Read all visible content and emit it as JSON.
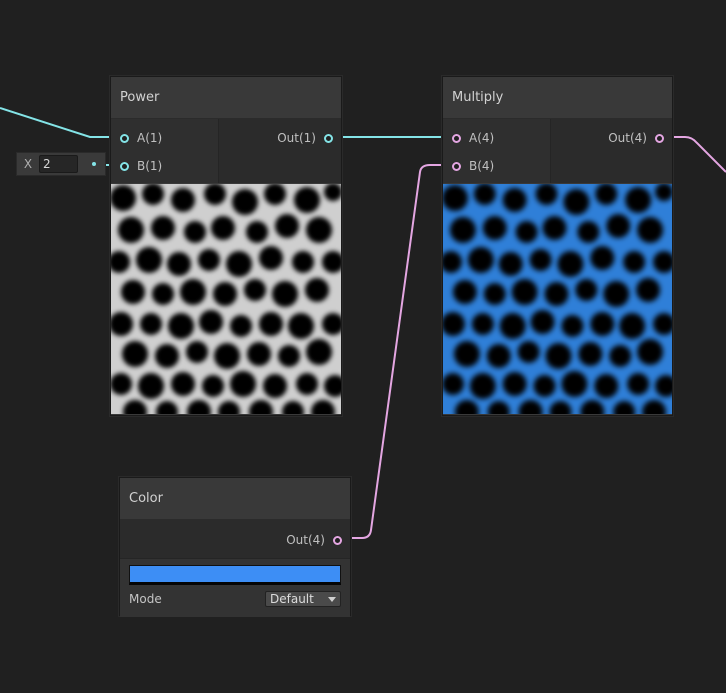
{
  "colors": {
    "wire_float": "#84e4e7",
    "wire_vector": "#e4a6e2",
    "color_value": "#3d8ef5"
  },
  "inline_field": {
    "label": "X",
    "value": "2"
  },
  "power_node": {
    "title": "Power",
    "inputs": [
      "A(1)",
      "B(1)"
    ],
    "output": "Out(1)"
  },
  "multiply_node": {
    "title": "Multiply",
    "inputs": [
      "A(4)",
      "B(4)"
    ],
    "output": "Out(4)"
  },
  "color_node": {
    "title": "Color",
    "output": "Out(4)",
    "mode_label": "Mode",
    "mode_value": "Default"
  }
}
